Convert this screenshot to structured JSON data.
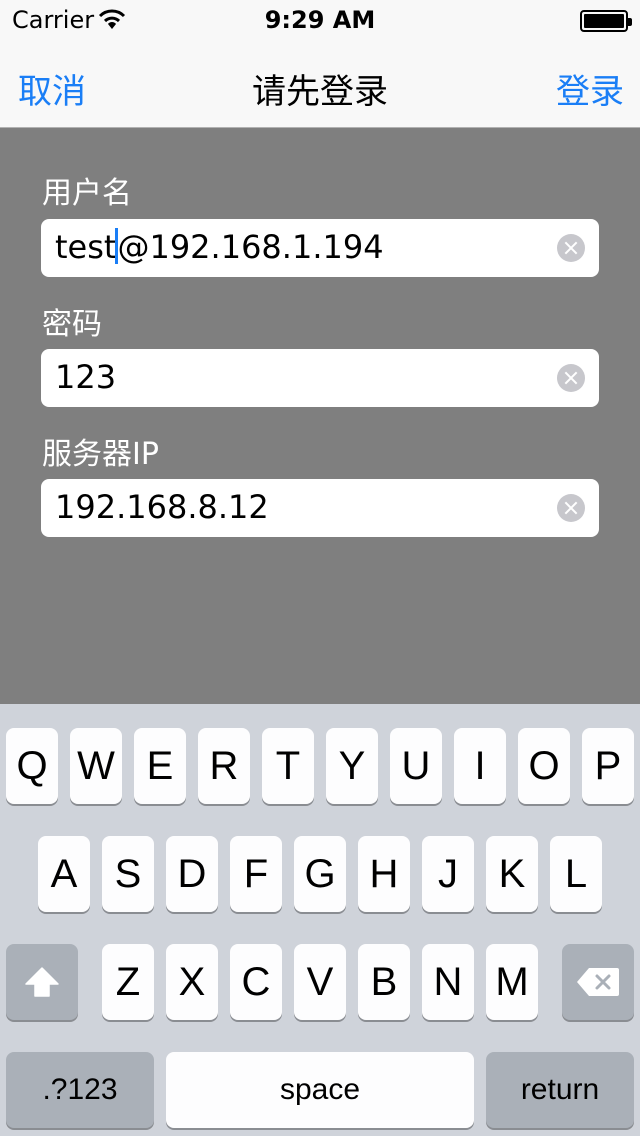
{
  "status": {
    "carrier": "Carrier",
    "time": "9:29 AM"
  },
  "nav": {
    "cancel": "取消",
    "title": "请先登录",
    "login": "登录"
  },
  "form": {
    "username": {
      "label": "用户名",
      "value_before_caret": "test",
      "value_after_caret": "@192.168.1.194"
    },
    "password": {
      "label": "密码",
      "value": "123"
    },
    "server": {
      "label": "服务器IP",
      "value": "192.168.8.12"
    }
  },
  "keyboard": {
    "row1": [
      "Q",
      "W",
      "E",
      "R",
      "T",
      "Y",
      "U",
      "I",
      "O",
      "P"
    ],
    "row2": [
      "A",
      "S",
      "D",
      "F",
      "G",
      "H",
      "J",
      "K",
      "L"
    ],
    "row3": [
      "Z",
      "X",
      "C",
      "V",
      "B",
      "N",
      "M"
    ],
    "numbers": ".?123",
    "space": "space",
    "return": "return",
    "shift_icon": "shift-icon",
    "delete_icon": "delete-icon"
  }
}
